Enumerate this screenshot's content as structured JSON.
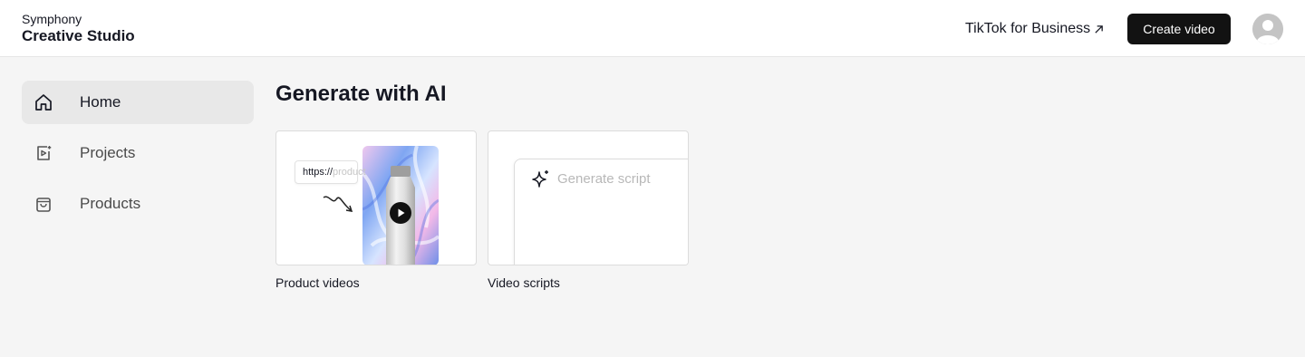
{
  "header": {
    "brand_top": "Symphony",
    "brand_main": "Creative Studio",
    "business_link": "TikTok for Business",
    "business_link_icon": "external-arrow-icon",
    "create_button": "Create video",
    "avatar_icon": "user-avatar-icon"
  },
  "sidebar": {
    "items": [
      {
        "label": "Home",
        "icon": "home-icon",
        "active": true
      },
      {
        "label": "Projects",
        "icon": "projects-icon",
        "active": false
      },
      {
        "label": "Products",
        "icon": "bag-icon",
        "active": false
      }
    ]
  },
  "main": {
    "title": "Generate with AI",
    "cards": [
      {
        "label": "Product videos",
        "url_prefix": "https://",
        "url_suffix": "product",
        "icon": "play-icon"
      },
      {
        "label": "Video scripts",
        "placeholder": "Generate script",
        "icon": "sparkle-icon"
      }
    ]
  },
  "colors": {
    "accent_dark": "#121212",
    "page_bg": "#f5f5f5",
    "active_nav_bg": "#e8e8e8"
  }
}
